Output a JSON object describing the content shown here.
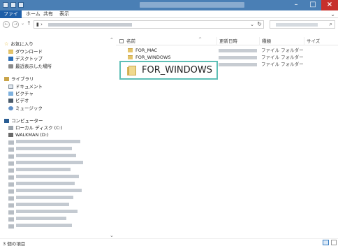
{
  "ribbon": {
    "tabs": [
      {
        "label": "ファイル"
      },
      {
        "label": "ホーム"
      },
      {
        "label": "共有"
      },
      {
        "label": "表示"
      }
    ]
  },
  "navpane": {
    "favorites": "お気に入り",
    "downloads": "ダウンロード",
    "desktop": "デスクトップ",
    "recent": "最近表示した場所",
    "libraries": "ライブラリ",
    "documents": "ドキュメント",
    "pictures": "ピクチャ",
    "videos": "ビデオ",
    "music": "ミュージック",
    "computer": "コンピューター",
    "local_disk": "ローカル ディスク (C:)",
    "walkman": "WALKMAN (D:)"
  },
  "columns": {
    "name": "名前",
    "date": "更新日時",
    "type": "種類",
    "size": "サイズ"
  },
  "files": [
    {
      "name": "FOR_MAC",
      "type": "ファイル フォルダー"
    },
    {
      "name": "FOR_WINDOWS",
      "type": "ファイル フォルダー"
    },
    {
      "name": "",
      "type": "ファイル フォルダー"
    }
  ],
  "callout": {
    "name": "FOR_WINDOWS"
  },
  "status": {
    "count": "3 個の項目"
  },
  "colors": {
    "accent": "#1f5fa8",
    "callout_border": "#5ebfb6",
    "close_button": "#c7302c"
  }
}
